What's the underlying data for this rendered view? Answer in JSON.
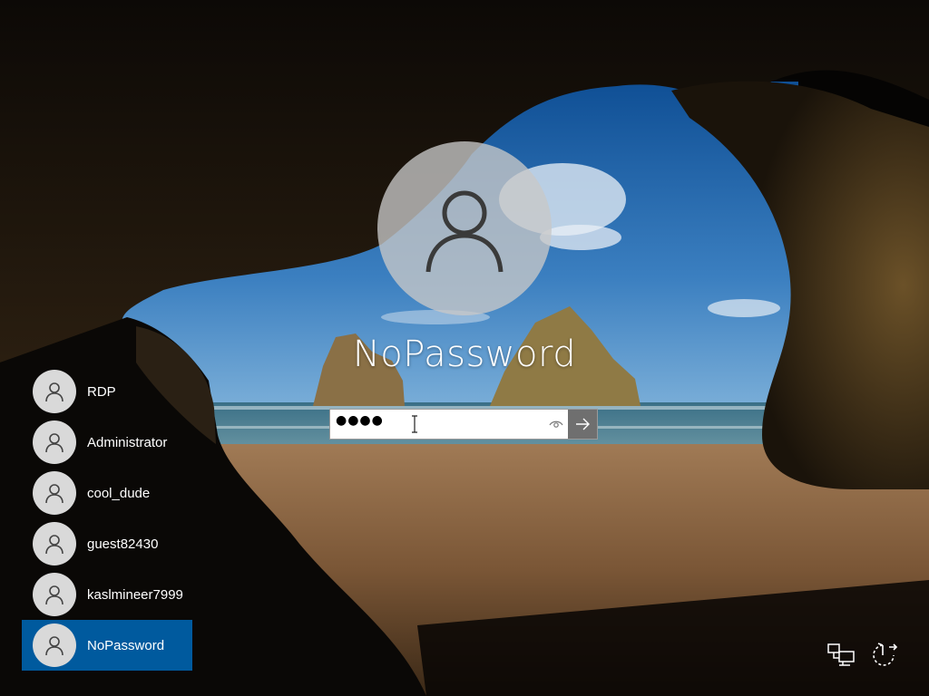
{
  "login": {
    "display_name": "NoPassword",
    "password_masked": "●●●●"
  },
  "users": [
    {
      "label": "RDP",
      "selected": false
    },
    {
      "label": "Administrator",
      "selected": false
    },
    {
      "label": "cool_dude",
      "selected": false
    },
    {
      "label": "guest82430",
      "selected": false
    },
    {
      "label": "kaslmineer7999",
      "selected": false
    },
    {
      "label": "NoPassword",
      "selected": true
    }
  ],
  "tray": {
    "network_icon": "network-icon",
    "power_icon": "power-icon"
  },
  "colors": {
    "selected_user_bg": "#005a9e",
    "submit_button_bg": "#6f6f6f"
  }
}
